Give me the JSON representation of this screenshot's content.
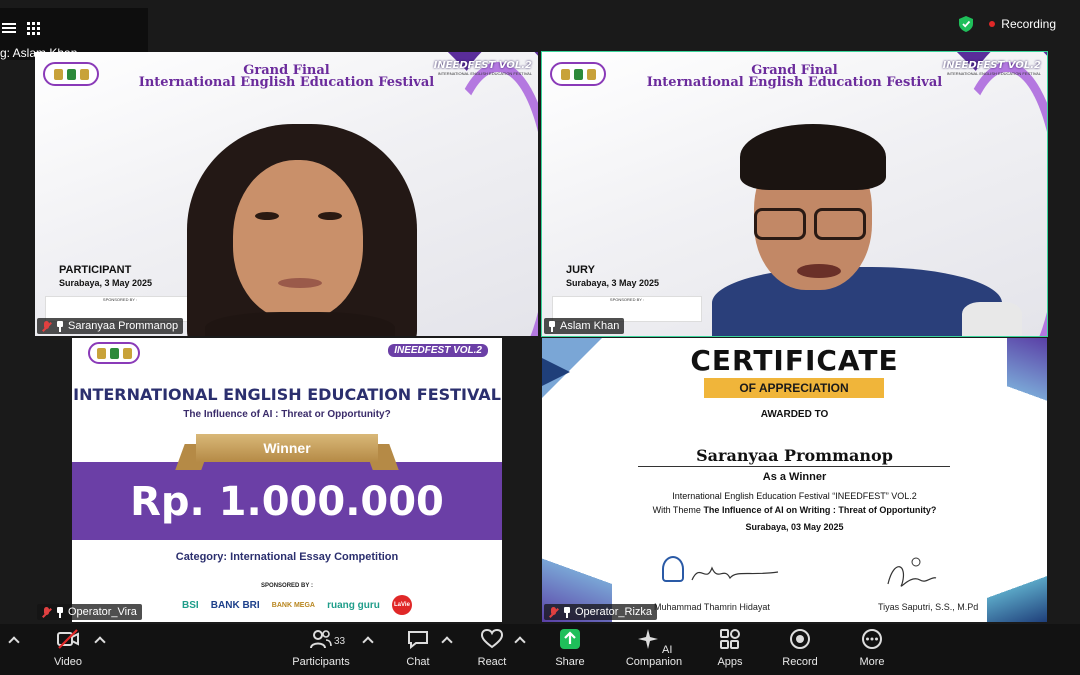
{
  "app": {
    "speaker_label": "g: Aslam Khan",
    "recording_label": "Recording"
  },
  "tiles": [
    {
      "name": "Saranyaa Prommanop",
      "banner_title_line1": "Grand Final",
      "banner_title_line2": "International English Education Festival",
      "event_logo": "INEEDFEST VOL.2",
      "event_logo_sub": "INTERNATIONAL ENGLISH EDUCATION FESTIVAL",
      "role": "PARTICIPANT",
      "date": "Surabaya, 3 May 2025",
      "sponsored_by": "SPONSORED BY :"
    },
    {
      "name": "Aslam Khan",
      "banner_title_line1": "Grand Final",
      "banner_title_line2": "International English Education Festival",
      "event_logo": "INEEDFEST VOL.2",
      "event_logo_sub": "INTERNATIONAL ENGLISH EDUCATION FESTIVAL",
      "role": "JURY",
      "date": "Surabaya, 3 May 2025",
      "sponsored_by": "SPONSORED BY :"
    },
    {
      "name": "Operator_Vira",
      "event_logo": "INEEDFEST VOL.2",
      "title": "INTERNATIONAL ENGLISH EDUCATION FESTIVAL",
      "subtitle": "The Influence of AI : Threat or Opportunity?",
      "ribbon": "Winner",
      "amount": "Rp. 1.000.000",
      "category": "Category: International Essay Competition",
      "sponsored_by": "SPONSORED BY :",
      "sponsors": [
        "BSI",
        "BANK BRI",
        "BANK MEGA",
        "ruang guru",
        "LaVie"
      ]
    },
    {
      "name": "Operator_Rizka",
      "cert_title": "CERTIFICATE",
      "cert_band": "OF APPRECIATION",
      "awarded_to": "AWARDED TO",
      "recipient": "Saranyaa Prommanop",
      "as_winner": "As a Winner",
      "line1": "International English Education Festival “INEEDFEST” VOL.2",
      "line2_prefix": "With Theme ",
      "line2_theme": "The Influence of AI on Writing : Threat of Opportunity?",
      "line3": "Surabaya, 03 May 2025",
      "sig1": "Muhammad Thamrin Hidayat",
      "sig2": "Tiyas Saputri, S.S., M.Pd"
    }
  ],
  "toolbar": {
    "video": "Video",
    "participants": "Participants",
    "participants_count": "33",
    "chat": "Chat",
    "react": "React",
    "share": "Share",
    "ai": "AI Companion",
    "apps": "Apps",
    "record": "Record",
    "more": "More"
  },
  "colors": {
    "active_border": "#39d49a",
    "share_green": "#1fbf5a",
    "festival_purple": "#6b3fa6",
    "cert_gold": "#f0b53a"
  }
}
